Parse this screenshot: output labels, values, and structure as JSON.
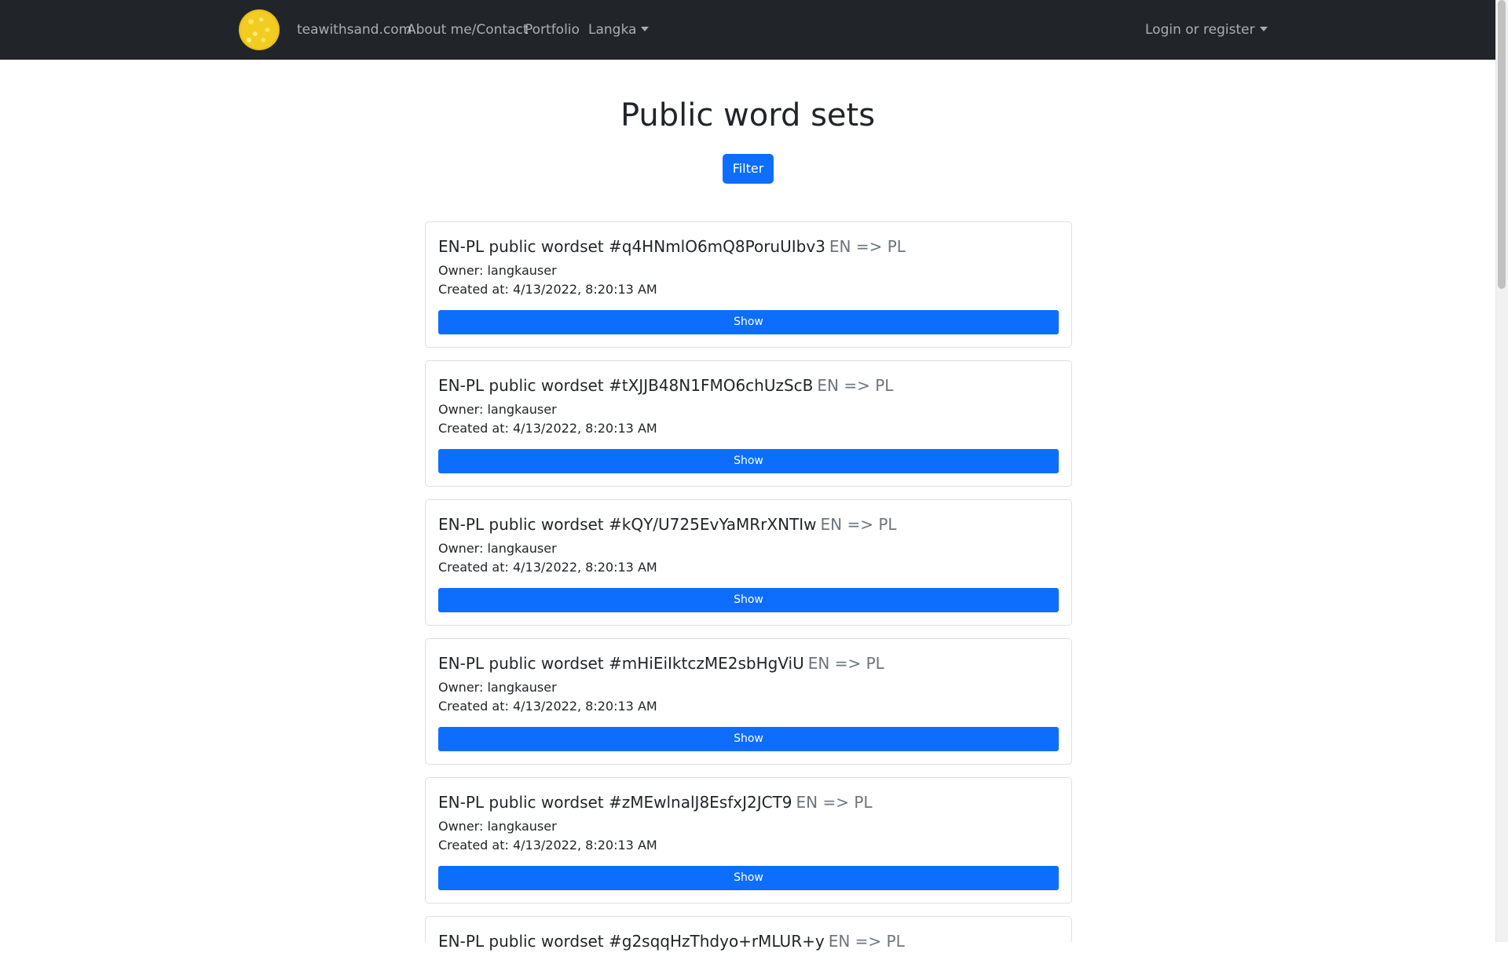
{
  "navbar": {
    "logo": "sand-circle-logo",
    "items": [
      {
        "label": "teawithsand.com"
      },
      {
        "label": "About me/Contact"
      },
      {
        "label": "Portfolio"
      },
      {
        "label": "Langka"
      }
    ],
    "login_label": "Login or register"
  },
  "main": {
    "title": "Public word sets",
    "filter_label": "Filter",
    "wordsets": [
      {
        "title": "EN-PL public wordset #q4HNmlO6mQ8PoruUIbv3",
        "subtitle": "EN => PL",
        "owner": "Owner: langkauser",
        "created": "Created at: 4/13/2022, 8:20:13 AM",
        "button": "Show"
      },
      {
        "title": "EN-PL public wordset #tXJJB48N1FMO6chUzScB",
        "subtitle": "EN => PL",
        "owner": "Owner: langkauser",
        "created": "Created at: 4/13/2022, 8:20:13 AM",
        "button": "Show"
      },
      {
        "title": "EN-PL public wordset #kQY/U725EvYaMRrXNTIw",
        "subtitle": "EN => PL",
        "owner": "Owner: langkauser",
        "created": "Created at: 4/13/2022, 8:20:13 AM",
        "button": "Show"
      },
      {
        "title": "EN-PL public wordset #mHiEiIktczME2sbHgViU",
        "subtitle": "EN => PL",
        "owner": "Owner: langkauser",
        "created": "Created at: 4/13/2022, 8:20:13 AM",
        "button": "Show"
      },
      {
        "title": "EN-PL public wordset #zMEwlnalJ8EsfxJ2JCT9",
        "subtitle": "EN => PL",
        "owner": "Owner: langkauser",
        "created": "Created at: 4/13/2022, 8:20:13 AM",
        "button": "Show"
      },
      {
        "title": "EN-PL public wordset #g2sqqHzThdyo+rMLUR+y",
        "subtitle": "EN => PL"
      }
    ]
  },
  "colors": {
    "navbar_bg": "#212529",
    "primary": "#0d6efd",
    "muted": "#6c757d"
  }
}
